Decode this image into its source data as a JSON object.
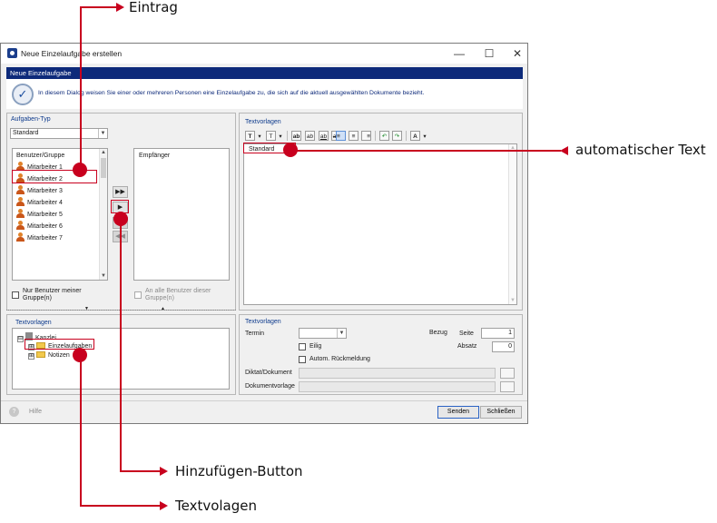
{
  "window": {
    "title": "Neue Einzelaufgabe erstellen",
    "minimize": "—",
    "maximize": "☐",
    "close": "✕"
  },
  "header": {
    "bar_title": "Neue Einzelaufgabe",
    "info": "In diesem Dialog weisen Sie einer oder mehreren Personen eine Einzelaufgabe zu, die sich auf die aktuell ausgewählten Dokumente bezieht."
  },
  "left": {
    "type_label": "Aufgaben-Typ",
    "type_value": "Standard",
    "users_header": "Benutzer/Gruppe",
    "users": [
      "Mitarbeiter 1",
      "Mitarbeiter 2",
      "Mitarbeiter 3",
      "Mitarbeiter 4",
      "Mitarbeiter 5",
      "Mitarbeiter 6",
      "Mitarbeiter 7"
    ],
    "recipients_header": "Empfänger",
    "move_buttons": [
      "▶▶",
      "▶",
      "◀",
      "◀◀"
    ],
    "only_my_group": "Nur Benutzer meiner Gruppe(n)",
    "to_all_users": "An alle Benutzer dieser Gruppe(n)",
    "splitter_arrows": [
      "▼",
      "▲"
    ]
  },
  "templates_tree": {
    "label": "Textvorlagen",
    "root": "Kanzlei",
    "children": [
      "Einzelaufgaben",
      "Notizen"
    ],
    "expand": "⊟",
    "collapse": "⊞"
  },
  "right": {
    "label": "Textvorlagen",
    "toolbar": [
      "T",
      "▾",
      "T",
      "▾",
      "ab",
      "ab",
      "ab",
      "ab",
      "≡",
      "≡",
      "≡",
      "↶",
      "↷",
      "A",
      "▾"
    ],
    "editor_text": "Standard"
  },
  "details": {
    "label": "Textvorlagen",
    "termin_label": "Termin",
    "termin_value": "",
    "bezug_label": "Bezug",
    "seite_label": "Seite",
    "seite_value": "1",
    "absatz_label": "Absatz",
    "absatz_value": "0",
    "eilig_label": "Eilig",
    "rueckmeldung_label": "Autom. Rückmeldung",
    "diktat_label": "Diktat/Dokument",
    "vorlage_label": "Dokumentvorlage"
  },
  "footer": {
    "help_label": "Hilfe",
    "help_icon": "?",
    "send_label": "Senden",
    "close_label": "Schließen"
  },
  "annotations": {
    "eintrag": "Eintrag",
    "automatischer_text": "automatischer Text",
    "hinzufuegen_button": "Hinzufügen-Button",
    "textvolagen": "Textvolagen"
  },
  "colors": {
    "accent": "#c8001e",
    "header_bar": "#0d2a7a"
  }
}
